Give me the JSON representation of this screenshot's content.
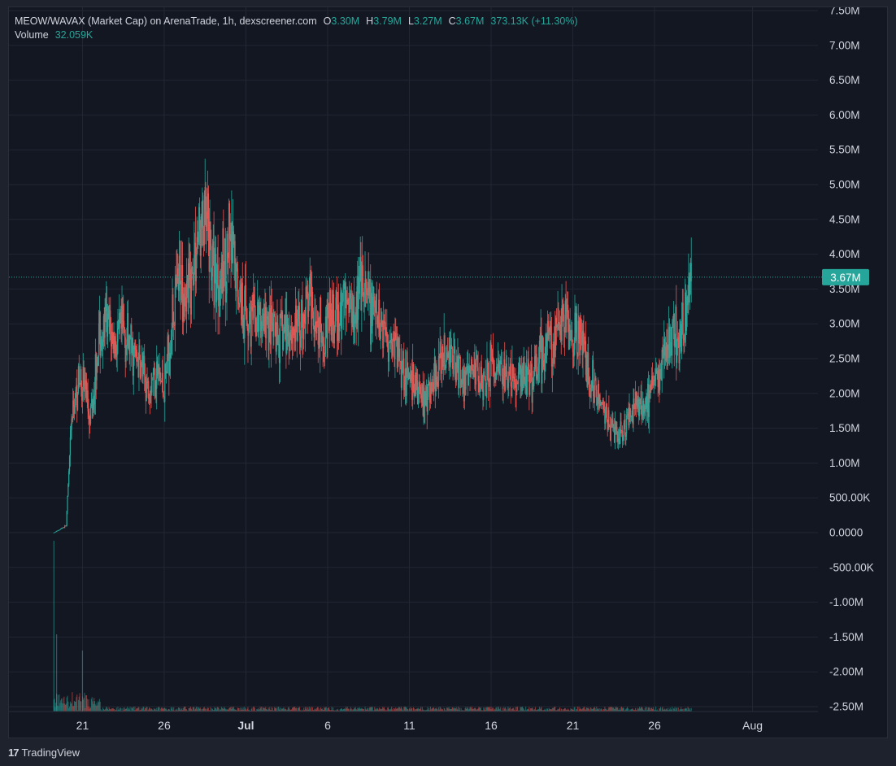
{
  "legend": {
    "title": "MEOW/WAVAX (Market Cap) on ArenaTrade, 1h, dexscreener.com",
    "o_label": "O",
    "o_value": "3.30M",
    "h_label": "H",
    "h_value": "3.79M",
    "l_label": "L",
    "l_value": "3.27M",
    "c_label": "C",
    "c_value": "3.67M",
    "change": "373.13K (+11.30%)",
    "volume_label": "Volume",
    "volume_value": "32.059K"
  },
  "price_label": "3.67M",
  "brand": {
    "logo": "17",
    "name": "TradingView"
  },
  "colors": {
    "background": "#131722",
    "up": "#26a69a",
    "down": "#ef5350",
    "grid": "#232733",
    "axis_text": "#d1d4dc",
    "price_line": "#26a69a"
  },
  "chart_data": {
    "type": "candlestick",
    "title": "MEOW/WAVAX (Market Cap) on ArenaTrade, 1h, dexscreener.com",
    "interval": "1h",
    "y_tick_labels": [
      "-2.50M",
      "-2.00M",
      "-1.50M",
      "-1.00M",
      "-500.00K",
      "0.0000",
      "500.00K",
      "1.00M",
      "1.50M",
      "2.00M",
      "2.50M",
      "3.00M",
      "3.50M",
      "4.00M",
      "4.50M",
      "5.00M",
      "5.50M",
      "6.00M",
      "6.50M",
      "7.00M",
      "7.50M"
    ],
    "y_ticks": [
      -2500000,
      -2000000,
      -1500000,
      -1000000,
      -500000,
      0,
      500000,
      1000000,
      1500000,
      2000000,
      2500000,
      3000000,
      3500000,
      4000000,
      4500000,
      5000000,
      5500000,
      6000000,
      6500000,
      7000000,
      7500000
    ],
    "ylim": [
      -2500000,
      7500000
    ],
    "x_tick_labels": [
      "21",
      "26",
      "Jul",
      "6",
      "11",
      "16",
      "21",
      "26",
      "Aug"
    ],
    "x_ticks": [
      "2024-06-21",
      "2024-06-26",
      "2024-07-01",
      "2024-07-06",
      "2024-07-11",
      "2024-07-16",
      "2024-07-21",
      "2024-07-26",
      "2024-08-01"
    ],
    "xlim": [
      "2024-06-16T12:00",
      "2024-08-05T00:00"
    ],
    "last_price": 3670000,
    "grid": true,
    "series": [
      {
        "name": "Market Cap",
        "kind": "close_path",
        "x": [
          "2024-06-20T00:00",
          "2024-06-20T08:00",
          "2024-06-20T16:00",
          "2024-06-21T00:00",
          "2024-06-21T12:00",
          "2024-06-22T00:00",
          "2024-06-22T12:00",
          "2024-06-23T00:00",
          "2024-06-23T12:00",
          "2024-06-24T00:00",
          "2024-06-24T12:00",
          "2024-06-25T00:00",
          "2024-06-25T12:00",
          "2024-06-26T00:00",
          "2024-06-26T12:00",
          "2024-06-27T00:00",
          "2024-06-27T12:00",
          "2024-06-28T00:00",
          "2024-06-28T12:00",
          "2024-06-29T00:00",
          "2024-06-29T12:00",
          "2024-06-30T00:00",
          "2024-06-30T12:00",
          "2024-07-01T00:00",
          "2024-07-01T12:00",
          "2024-07-02T00:00",
          "2024-07-02T12:00",
          "2024-07-03T00:00",
          "2024-07-03T12:00",
          "2024-07-04T00:00",
          "2024-07-04T12:00",
          "2024-07-05T00:00",
          "2024-07-05T12:00",
          "2024-07-06T00:00",
          "2024-07-06T12:00",
          "2024-07-07T00:00",
          "2024-07-07T12:00",
          "2024-07-08T00:00",
          "2024-07-08T12:00",
          "2024-07-09T00:00",
          "2024-07-09T12:00",
          "2024-07-10T00:00",
          "2024-07-10T12:00",
          "2024-07-11T00:00",
          "2024-07-11T12:00",
          "2024-07-12T00:00",
          "2024-07-12T12:00",
          "2024-07-13T00:00",
          "2024-07-13T12:00",
          "2024-07-14T00:00",
          "2024-07-14T12:00",
          "2024-07-15T00:00",
          "2024-07-15T12:00",
          "2024-07-16T00:00",
          "2024-07-16T12:00",
          "2024-07-17T00:00",
          "2024-07-17T12:00",
          "2024-07-18T00:00",
          "2024-07-18T12:00",
          "2024-07-19T00:00",
          "2024-07-19T12:00",
          "2024-07-20T00:00",
          "2024-07-20T12:00",
          "2024-07-21T00:00",
          "2024-07-21T12:00",
          "2024-07-22T00:00",
          "2024-07-22T12:00",
          "2024-07-23T00:00",
          "2024-07-23T12:00",
          "2024-07-24T00:00",
          "2024-07-24T12:00",
          "2024-07-25T00:00",
          "2024-07-25T12:00",
          "2024-07-26T00:00",
          "2024-07-26T12:00",
          "2024-07-27T00:00",
          "2024-07-27T12:00",
          "2024-07-28T00:00",
          "2024-07-28T06:00"
        ],
        "values": [
          100000,
          1600000,
          2100000,
          2250000,
          1700000,
          2800000,
          3000000,
          2700000,
          2900000,
          2600000,
          2400000,
          2100000,
          2350000,
          2050000,
          3100000,
          3650000,
          3400000,
          4200000,
          4450000,
          3800000,
          3650000,
          4100000,
          3550000,
          3150000,
          3000000,
          3050000,
          2900000,
          2750000,
          2950000,
          2900000,
          3100000,
          3400000,
          2900000,
          3050000,
          3000000,
          3350000,
          3300000,
          3400000,
          3300000,
          3050000,
          2950000,
          2700000,
          2500000,
          2150000,
          2050000,
          1950000,
          2150000,
          2450000,
          2600000,
          2350000,
          2150000,
          2400000,
          2250000,
          2450000,
          2300000,
          2200000,
          2150000,
          2250000,
          2200000,
          2500000,
          2850000,
          2750000,
          3100000,
          2800000,
          2750000,
          2300000,
          2000000,
          1700000,
          1450000,
          1450000,
          1650000,
          1900000,
          1850000,
          2100000,
          2400000,
          2800000,
          2850000,
          3150000,
          3670000
        ]
      },
      {
        "name": "Volume",
        "kind": "histogram",
        "last_value": 32059
      }
    ]
  }
}
